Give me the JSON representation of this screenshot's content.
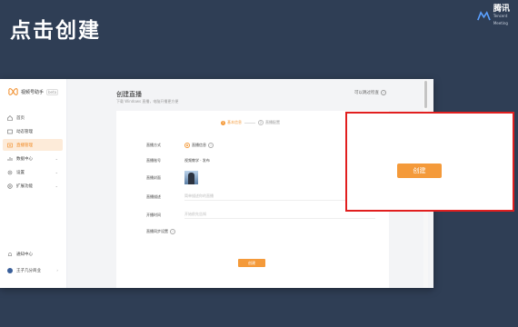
{
  "slide": {
    "title": "点击创建"
  },
  "brand": {
    "name": "腾讯",
    "sub": "Tencent Meeting"
  },
  "app": {
    "logo_name": "视频号助手",
    "logo_tag": "beta",
    "nav": [
      {
        "label": "首页",
        "icon": "home-icon",
        "active": false
      },
      {
        "label": "动态管理",
        "icon": "video-icon",
        "active": false
      },
      {
        "label": "直播管理",
        "icon": "live-icon",
        "active": true
      },
      {
        "label": "数据中心",
        "icon": "chart-icon",
        "active": false,
        "expandable": true
      },
      {
        "label": "设置",
        "icon": "gear-icon",
        "active": false,
        "expandable": true
      },
      {
        "label": "扩展功能",
        "icon": "extension-icon",
        "active": false,
        "expandable": true
      }
    ],
    "bottom": {
      "notify": "通知中心",
      "user": "王子几分商业"
    },
    "page_title": "创建直播",
    "page_sub": "下载 Windows 直播，电脑开播更方便",
    "top_link": "可以跳过检查",
    "steps": [
      {
        "num": "1",
        "label": "基本信息"
      },
      {
        "num": "2",
        "label": "直播配置"
      }
    ],
    "form": {
      "type_label": "直播方式",
      "type_value": "直播信息",
      "account_label": "直播账号",
      "account_value": "视频教学 · 发布",
      "cover_label": "直播封面",
      "title_label": "直播描述",
      "title_placeholder": "简单描述你的直播",
      "time_label": "开播时间",
      "time_placeholder": "开始前先告知",
      "extra_label": "直播同步设置"
    },
    "create_label": "创建"
  },
  "zoom": {
    "create_label": "创建"
  },
  "colors": {
    "accent": "#f49a3a",
    "highlight_border": "#e11f1f",
    "background": "#2f3e55"
  }
}
